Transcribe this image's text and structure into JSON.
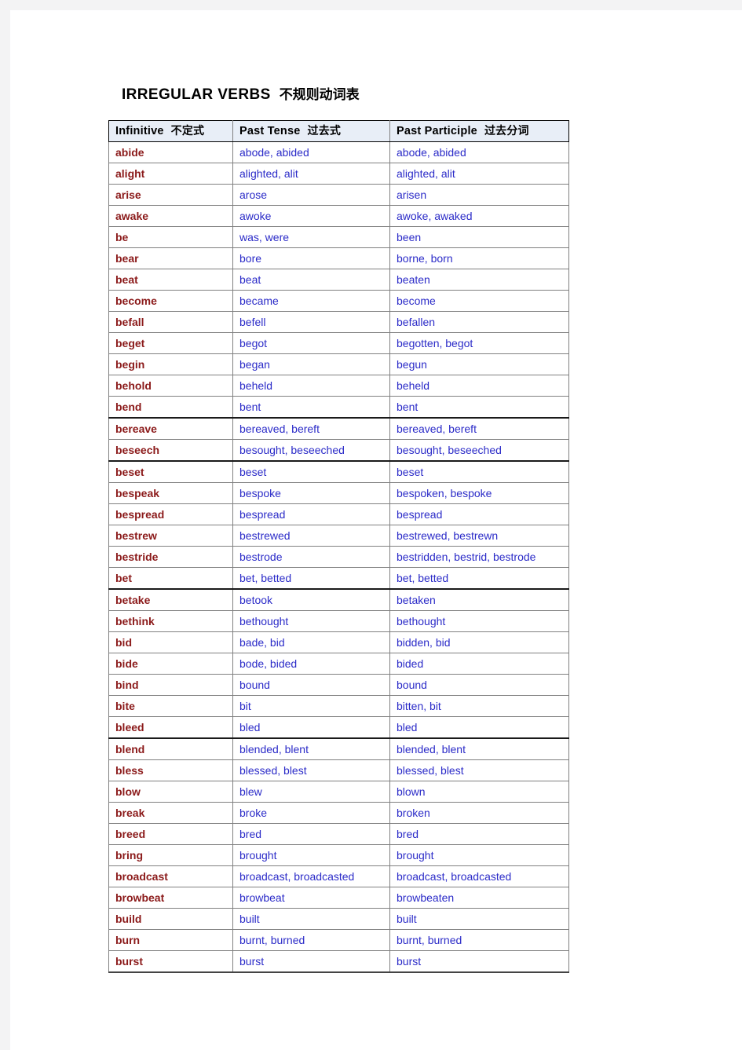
{
  "document": {
    "title_en": "IRREGULAR VERBS",
    "title_cjk": "不规则动词表"
  },
  "table": {
    "headers": [
      {
        "en": "Infinitive",
        "cjk": "不定式"
      },
      {
        "en": "Past Tense",
        "cjk": "过去式"
      },
      {
        "en": "Past Participle",
        "cjk": "过去分词"
      }
    ],
    "colors": {
      "infinitive": "#8b1a1a",
      "forms": "#2b2bc8",
      "header_bg": "#e8eef7",
      "border": "#808080",
      "divider": "#1a1a1a"
    },
    "rows": [
      {
        "infinitive": "abide",
        "past": "abode, abided",
        "participle": "abode, abided"
      },
      {
        "infinitive": "alight",
        "past": "alighted, alit",
        "participle": "alighted, alit"
      },
      {
        "infinitive": "arise",
        "past": "arose",
        "participle": "arisen"
      },
      {
        "infinitive": "awake",
        "past": "awoke",
        "participle": "awoke, awaked"
      },
      {
        "infinitive": "be",
        "past": "was, were",
        "participle": "been"
      },
      {
        "infinitive": "bear",
        "past": "bore",
        "participle": "borne, born"
      },
      {
        "infinitive": "beat",
        "past": "beat",
        "participle": "beaten"
      },
      {
        "infinitive": "become",
        "past": "became",
        "participle": "become"
      },
      {
        "infinitive": "befall",
        "past": "befell",
        "participle": "befallen"
      },
      {
        "infinitive": "beget",
        "past": "begot",
        "participle": "begotten, begot"
      },
      {
        "infinitive": "begin",
        "past": "began",
        "participle": "begun"
      },
      {
        "infinitive": "behold",
        "past": "beheld",
        "participle": "beheld"
      },
      {
        "infinitive": "bend",
        "past": "bent",
        "participle": "bent"
      },
      {
        "infinitive": "bereave",
        "past": "bereaved, bereft",
        "participle": "bereaved, bereft",
        "section": "start"
      },
      {
        "infinitive": "beseech",
        "past": "besought, beseeched",
        "participle": "besought, beseeched",
        "section": "end"
      },
      {
        "infinitive": "beset",
        "past": "beset",
        "participle": "beset"
      },
      {
        "infinitive": "bespeak",
        "past": "bespoke",
        "participle": "bespoken, bespoke"
      },
      {
        "infinitive": "bespread",
        "past": "bespread",
        "participle": "bespread"
      },
      {
        "infinitive": "bestrew",
        "past": "bestrewed",
        "participle": "bestrewed, bestrewn"
      },
      {
        "infinitive": "bestride",
        "past": "bestrode",
        "participle": "bestridden, bestrid, bestrode"
      },
      {
        "infinitive": "bet",
        "past": "bet, betted",
        "participle": "bet, betted"
      },
      {
        "infinitive": "betake",
        "past": "betook",
        "participle": "betaken",
        "section": "start"
      },
      {
        "infinitive": "bethink",
        "past": "bethought",
        "participle": "bethought"
      },
      {
        "infinitive": "bid",
        "past": "bade, bid",
        "participle": "bidden, bid"
      },
      {
        "infinitive": "bide",
        "past": "bode, bided",
        "participle": "bided"
      },
      {
        "infinitive": "bind",
        "past": "bound",
        "participle": "bound"
      },
      {
        "infinitive": "bite",
        "past": "bit",
        "participle": "bitten, bit"
      },
      {
        "infinitive": "bleed",
        "past": "bled",
        "participle": "bled",
        "section": "end"
      },
      {
        "infinitive": "blend",
        "past": "blended, blent",
        "participle": "blended, blent"
      },
      {
        "infinitive": "bless",
        "past": "blessed, blest",
        "participle": "blessed, blest"
      },
      {
        "infinitive": "blow",
        "past": "blew",
        "participle": "blown"
      },
      {
        "infinitive": "break",
        "past": "broke",
        "participle": "broken"
      },
      {
        "infinitive": "breed",
        "past": "bred",
        "participle": "bred"
      },
      {
        "infinitive": "bring",
        "past": "brought",
        "participle": "brought"
      },
      {
        "infinitive": "broadcast",
        "past": "broadcast, broadcasted",
        "participle": "broadcast, broadcasted"
      },
      {
        "infinitive": "browbeat",
        "past": "browbeat",
        "participle": "browbeaten"
      },
      {
        "infinitive": "build",
        "past": "built",
        "participle": "built"
      },
      {
        "infinitive": "burn",
        "past": "burnt, burned",
        "participle": "burnt, burned"
      },
      {
        "infinitive": "burst",
        "past": "burst",
        "participle": "burst",
        "last": true
      }
    ]
  }
}
